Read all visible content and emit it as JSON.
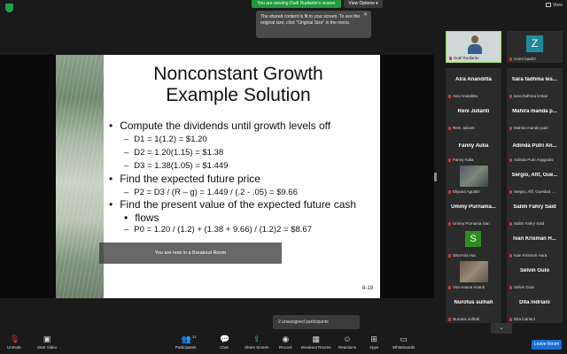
{
  "top": {
    "viewing_text": "You are viewing Dudi Rudianto's screen",
    "view_options": "View Options ▾",
    "view": "View"
  },
  "tooltip": {
    "text": "The shared content is fit to your screen. To see the original size, click \"Original Size\" in the menu."
  },
  "slide": {
    "title_line1": "Nonconstant Growth",
    "title_line2": "Example Solution",
    "bullet1": "Compute the dividends until growth levels off",
    "d1": "D1 = 1(1.2) = $1.20",
    "d2": "D2 = 1.20(1.15) = $1.38",
    "d3": "D3 = 1.38(1.05) = $1.449",
    "bullet2": "Find the expected future price",
    "p2": "P2 = D3 / (R – g) = 1.449 / (.2 - .05) = $9.66",
    "bullet3_line1": "Find the present value of the expected future cash",
    "bullet3_line2": "flows",
    "p0": "P0 = 1.20 / (1.2) + (1.38 + 9.66) / (1.2)2 = $8.67",
    "page": "8-19"
  },
  "breakout_banner": "You are now in a Breakout Room",
  "unassigned": "2 unassigned participants",
  "gallery": [
    {
      "big": "",
      "small": "Dudi Rudianto"
    },
    {
      "big": "",
      "small": "zoom baa04"
    },
    {
      "big": "Aira Ananditta",
      "small": "Aira Ananditta"
    },
    {
      "big": "tiara fadhma les...",
      "small": "tiara fadhma lestari"
    },
    {
      "big": "Reni Julianti",
      "small": "Reni Julianti"
    },
    {
      "big": "Mahira manda p...",
      "small": "Mahira manda putri"
    },
    {
      "big": "Fanny Aulia",
      "small": "Fanny Aulia"
    },
    {
      "big": "Adinda Putri An...",
      "small": "Adinda Putri Anggraini"
    },
    {
      "big": "",
      "small": "Eliyana Agustin"
    },
    {
      "big": "Sergio, Afif, Gue...",
      "small": "Sergio, Afif, Gueskal, ..."
    },
    {
      "big": "Ummy Purnama...",
      "small": "Ummy Purnama Sari"
    },
    {
      "big": "Salim Fahry Said",
      "small": "Salim Fahry Said"
    },
    {
      "big": "",
      "small": "Sisa'Aria Hia"
    },
    {
      "big": "Ivan Krisman H...",
      "small": "Ivan Krisman Hura"
    },
    {
      "big": "",
      "small": "Vira Hasna Arianti"
    },
    {
      "big": "Selvin Gulo",
      "small": "Selvin Gulo"
    },
    {
      "big": "Nurotus sulhah",
      "small": "Nurotus sulhah"
    },
    {
      "big": "Dita indriani",
      "small": "Dita indriani"
    }
  ],
  "avatars": {
    "zoom": "Z",
    "sisa": "S"
  },
  "toolbar": {
    "unmute": "Unmute",
    "start_video": "Start Video",
    "participants": "Participants",
    "participants_count": "33",
    "chat": "Chat",
    "share_screen": "Share Screen",
    "record": "Record",
    "breakout_rooms": "Breakout Rooms",
    "reactions": "Reactions",
    "apps": "Apps",
    "whiteboards": "Whiteboards",
    "leave": "Leave Room"
  },
  "colors": {
    "accent_green": "#1f9a3c",
    "leave_blue": "#1a6ed8",
    "share_green": "#2ed35b"
  }
}
